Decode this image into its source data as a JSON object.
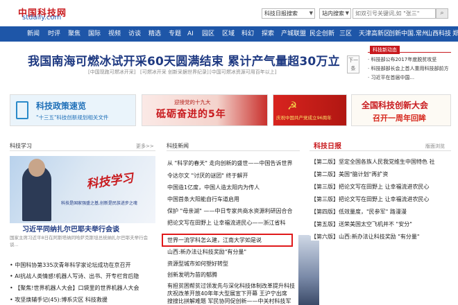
{
  "header": {
    "logo_cn": "中国科技网",
    "logo_en": "stdaily.com",
    "search_select": "科技日报搜索",
    "station_select": "站内搜索",
    "search_placeholder": "如双引号关键词,如 \"张三\""
  },
  "nav": [
    "新闻",
    "时评",
    "聚焦",
    "国际",
    "视频",
    "访谈",
    "精选",
    "专题",
    "AI",
    "园区",
    "区域",
    "科幻",
    "探索",
    "产城联盟",
    "民企创新",
    "三区",
    "天津高新区",
    "创新中国.常州",
    "山西科技",
    "郑"
  ],
  "headline": {
    "title": "我国南海可燃冰试开采60天圆满结束 累计产气量超30万立",
    "subs": [
      "[中国现跑可燃冰开采]",
      "[可燃冰开采 创新采据世界纪录]",
      "[中国可燃冰资源可用百年以上]"
    ],
    "next": "下一条"
  },
  "side": {
    "tag": "科技新动态",
    "items": [
      "· 科技部公布2017年度脱贫攻坚",
      "· 科技部部长会上首人重用科技部前方",
      "· 习近平在首届中国..."
    ]
  },
  "banners": [
    {
      "line1": "科技政策速览",
      "line2": "\"十三五\"科技创新规划相关文件"
    },
    {
      "line1": "迎接党的十九大",
      "line2": "砥砺奋进的5年"
    },
    {
      "line1": "庆祝中国共产党成立96周年"
    },
    {
      "line1": "全国科技创新大会",
      "line2": "召开一周年回眸"
    }
  ],
  "sections": {
    "left": {
      "title": "科技学习",
      "more": "更多>>"
    },
    "mid": {
      "title": "科技新闻"
    },
    "right": {
      "title": "科技日报",
      "more": "版面浏览"
    }
  },
  "left": {
    "photo_text": "科技学习",
    "photo_sub": "科技是国家强盛之基,创新是民族进步之魂",
    "caption": "习近平同纳扎尔巴耶夫举行会谈",
    "desc": "国家主席习近平8日在阿斯塔纳同哈萨克斯坦总统纳扎尔巴耶夫举行会谈...",
    "items": [
      "• 中国科协第335次青年科学家论坛成功在京召开",
      "• AI抗战人类情感!机器人写诗、出书、开专栏背后隐",
      "• 【聚焦!世界机器人大会】口袋里的世界机器人大会",
      "• 攻坚焕辅手记(45):博系灾区 科技救援"
    ]
  },
  "mid": {
    "items": [
      "从 \"科学的春天\" 走向创新的盛世——中国告诉世界",
      "令达尔文 \"讨厌的谜团\" 终于解开",
      "中国造1亿度，中国人造太阳内为传人",
      "中国首条大阳能自行车道启用",
      "保护 \"母亲湖\" ——中日专家共商水资源利研因合合",
      "把论文写在田野上 让幸福流进民心——浙江省科",
      "世界一流学科怎么建，江南大学如是说",
      "山西:新办法让科技奖励\"有分量\"",
      "资源型城市如何塑好转型",
      "创新发明为苗的郁腾",
      "有担贫困帮贫过领发先与深化科技体制改革提升科技",
      "庆祝改革开放40年年大型展宣下开幕 王沪宁出席",
      "搜搜比拼解难题 军民协同促创新——中关村科技军"
    ]
  },
  "right": {
    "items": [
      {
        "ed": "【第二版】",
        "t": "坚定全国各族人民我党维生中国特色 社"
      },
      {
        "ed": "【第二版】",
        "t": "美国\"脑计划\"再扩资"
      },
      {
        "ed": "【第三版】",
        "t": "把论文写在田野上 让幸福流进农民心"
      },
      {
        "ed": "【第三版】",
        "t": "把论文写在田野上 让幸福流进农民心"
      },
      {
        "ed": "【第四版】",
        "t": "低效量度，\"民参军\" 路漫漫"
      },
      {
        "ed": "【第五版】",
        "t": "送荣美国太空飞机并不 \"安分\""
      },
      {
        "ed": "【第六版】",
        "t": "山西:新办法让科技奖励 \"有分量\""
      }
    ]
  }
}
